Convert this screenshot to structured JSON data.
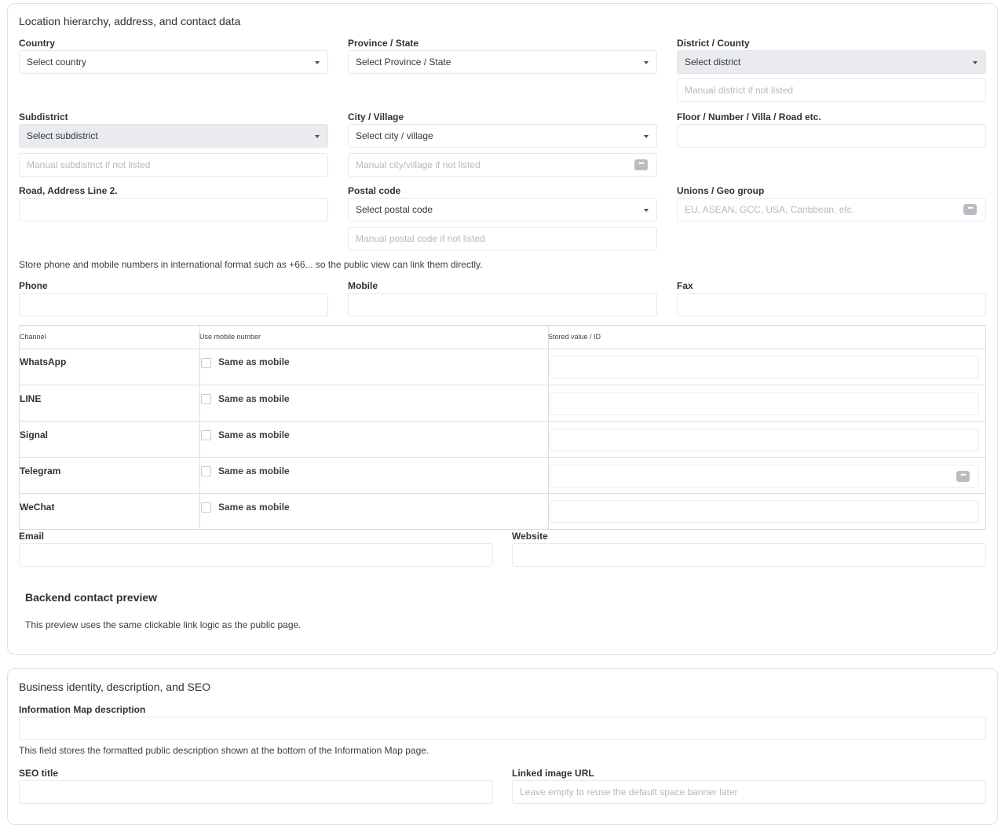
{
  "location_section": {
    "title": "Location hierarchy, address, and contact data",
    "country": {
      "label": "Country",
      "value": "Select country"
    },
    "province": {
      "label": "Province / State",
      "value": "Select Province / State"
    },
    "district": {
      "label": "District / County",
      "value": "Select district",
      "manual_placeholder": "Manual district if not listed"
    },
    "subdistrict": {
      "label": "Subdistrict",
      "value": "Select subdistrict",
      "manual_placeholder": "Manual subdistrict if not listed"
    },
    "city": {
      "label": "City / Village",
      "value": "Select city / village",
      "manual_placeholder": "Manual city/village if not listed"
    },
    "floor": {
      "label": "Floor / Number / Villa / Road etc.",
      "value": ""
    },
    "road": {
      "label": "Road, Address Line 2.",
      "value": ""
    },
    "postal": {
      "label": "Postal code",
      "value": "Select postal code",
      "manual_placeholder": "Manual postal code if not listed"
    },
    "unions": {
      "label": "Unions / Geo group",
      "placeholder": "EU, ASEAN, GCC, USA, Caribbean, etc."
    },
    "phone_hint": "Store phone and mobile numbers in international format such as +66... so the public view can link them directly.",
    "phone": {
      "label": "Phone",
      "value": ""
    },
    "mobile": {
      "label": "Mobile",
      "value": ""
    },
    "fax": {
      "label": "Fax",
      "value": ""
    },
    "channels_table": {
      "headers": [
        "Channel",
        "Use mobile number",
        "Stored value / ID"
      ],
      "rows": [
        {
          "channel": "WhatsApp",
          "same_label": "Same as mobile",
          "checked": false,
          "value": ""
        },
        {
          "channel": "LINE",
          "same_label": "Same as mobile",
          "checked": false,
          "value": ""
        },
        {
          "channel": "Signal",
          "same_label": "Same as mobile",
          "checked": false,
          "value": ""
        },
        {
          "channel": "Telegram",
          "same_label": "Same as mobile",
          "checked": false,
          "value": ""
        },
        {
          "channel": "WeChat",
          "same_label": "Same as mobile",
          "checked": false,
          "value": ""
        }
      ]
    },
    "email": {
      "label": "Email",
      "value": ""
    },
    "website": {
      "label": "Website",
      "value": ""
    },
    "preview": {
      "title": "Backend contact preview",
      "text": "This preview uses the same clickable link logic as the public page."
    }
  },
  "business_section": {
    "title": "Business identity, description, and SEO",
    "map_description": {
      "label": "Information Map description",
      "value": ""
    },
    "map_hint": "This field stores the formatted public description shown at the bottom of the Information Map page.",
    "seo_title": {
      "label": "SEO title",
      "value": ""
    },
    "linked_image": {
      "label": "Linked image URL",
      "placeholder": "Leave empty to reuse the default space banner later"
    }
  },
  "icons": {
    "caret": "caret-down-icon",
    "more": "more-dots-icon"
  }
}
